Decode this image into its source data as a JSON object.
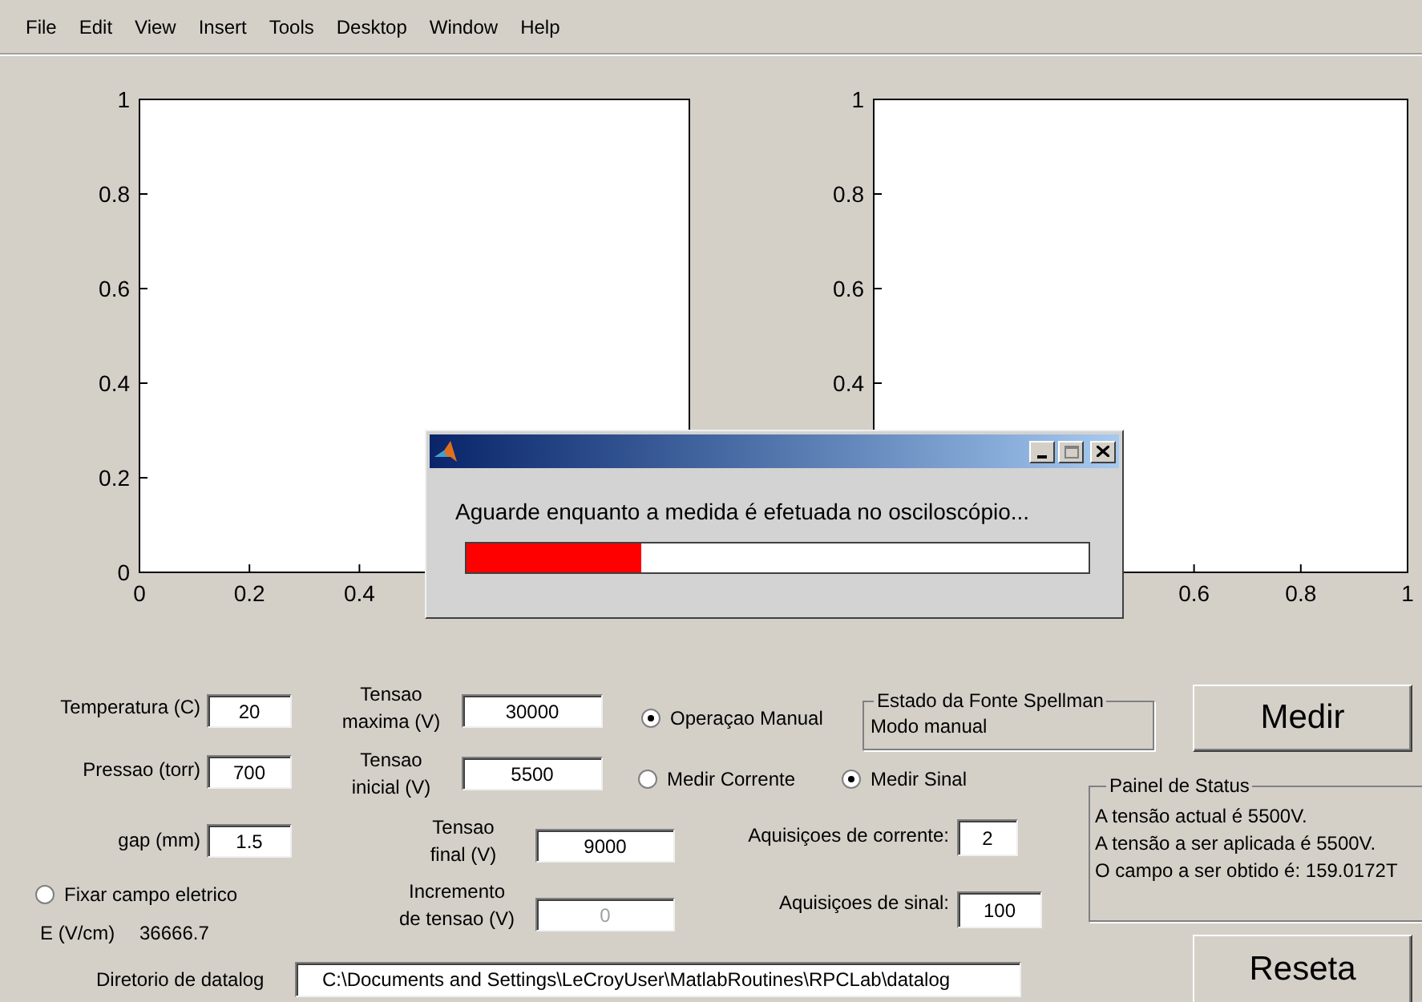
{
  "menu": [
    "File",
    "Edit",
    "View",
    "Insert",
    "Tools",
    "Desktop",
    "Window",
    "Help"
  ],
  "plots": [
    {
      "chart_data": {
        "type": "line",
        "xlim": [
          0,
          1
        ],
        "ylim": [
          0,
          1
        ],
        "xticks": [
          0,
          0.2,
          0.4
        ],
        "yticks": [
          0,
          0.2,
          0.4,
          0.6,
          0.8,
          1
        ]
      }
    },
    {
      "chart_data": {
        "type": "line",
        "xlim": [
          0,
          1
        ],
        "ylim": [
          0,
          1
        ],
        "xticks": [
          0.6,
          0.8,
          1
        ],
        "yticks": [
          0.4,
          0.6,
          0.8,
          1
        ]
      }
    }
  ],
  "left_fields": [
    {
      "label": "Temperatura (C)",
      "value": "20"
    },
    {
      "label": "Pressao (torr)",
      "value": "700"
    },
    {
      "label": "gap (mm)",
      "value": "1.5"
    }
  ],
  "voltage_fields": [
    {
      "label": "Tensao\nmaxima (V)",
      "value": "30000",
      "disabled": false
    },
    {
      "label": "Tensao\ninicial (V)",
      "value": "5500",
      "disabled": false
    },
    {
      "label": "Tensao\nfinal (V)",
      "value": "9000",
      "disabled": false
    },
    {
      "label": "Incremento\nde tensao (V)",
      "value": "0",
      "disabled": true
    }
  ],
  "mode_radio": {
    "label": "Operaçao Manual",
    "selected": true
  },
  "measure_radios": [
    {
      "label": "Medir Corrente",
      "selected": false
    },
    {
      "label": "Medir Sinal",
      "selected": true
    }
  ],
  "fixed_field_radio": {
    "label": "Fixar campo eletrico",
    "selected": false
  },
  "field_reading": {
    "label": "E (V/cm)",
    "value": "36666.7"
  },
  "acquisition_fields": [
    {
      "label": "Aquisiçoes de corrente:",
      "value": "2"
    },
    {
      "label": "Aquisiçoes de sinal:",
      "value": "100"
    }
  ],
  "source_status": {
    "title": "Estado da Fonte Spellman",
    "text": "Modo manual"
  },
  "status_panel": {
    "title": "Painel de Status",
    "lines": [
      "A tensão actual é 5500V.",
      "A tensão a ser aplicada é 5500V.",
      "O campo a ser obtido é: 159.0172T"
    ]
  },
  "buttons": [
    "Medir",
    "Reseta"
  ],
  "datalog": {
    "label": "Diretorio de datalog",
    "value": "C:\\Documents and Settings\\LeCroyUser\\MatlabRoutines\\RPCLab\\datalog"
  },
  "progress_dialog": {
    "message": "Aguarde enquanto a medida é efetuada no osciloscópio...",
    "level": 0.28
  }
}
